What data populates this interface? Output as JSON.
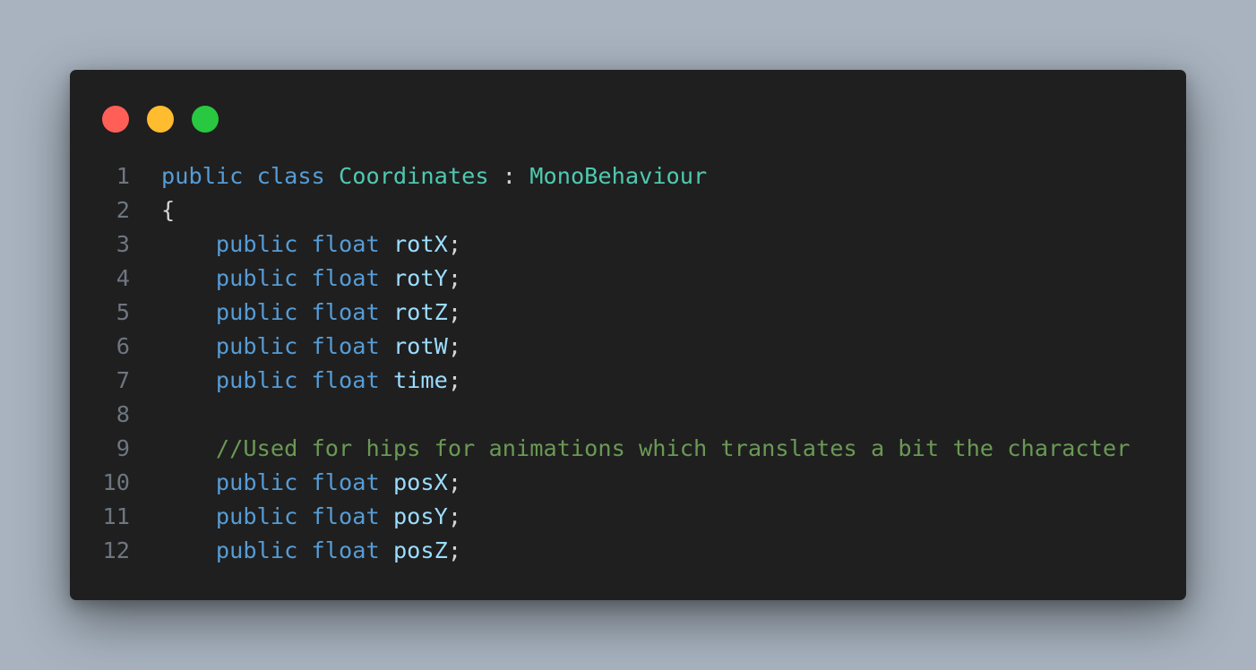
{
  "window": {
    "controls": [
      {
        "name": "close-dot",
        "color": "#ff5f57"
      },
      {
        "name": "minimize-dot",
        "color": "#febc2e"
      },
      {
        "name": "maximize-dot",
        "color": "#28c840"
      }
    ]
  },
  "code": {
    "lines": [
      {
        "number": "1",
        "tokens": [
          {
            "text": "public",
            "kind": "keyword"
          },
          {
            "text": " ",
            "kind": "space"
          },
          {
            "text": "class",
            "kind": "keyword"
          },
          {
            "text": " ",
            "kind": "space"
          },
          {
            "text": "Coordinates",
            "kind": "type"
          },
          {
            "text": " : ",
            "kind": "punct"
          },
          {
            "text": "MonoBehaviour",
            "kind": "type"
          }
        ]
      },
      {
        "number": "2",
        "tokens": [
          {
            "text": "{",
            "kind": "punct"
          }
        ]
      },
      {
        "number": "3",
        "tokens": [
          {
            "text": "    ",
            "kind": "space"
          },
          {
            "text": "public",
            "kind": "keyword"
          },
          {
            "text": " ",
            "kind": "space"
          },
          {
            "text": "float",
            "kind": "keyword"
          },
          {
            "text": " ",
            "kind": "space"
          },
          {
            "text": "rotX",
            "kind": "ident"
          },
          {
            "text": ";",
            "kind": "punct"
          }
        ]
      },
      {
        "number": "4",
        "tokens": [
          {
            "text": "    ",
            "kind": "space"
          },
          {
            "text": "public",
            "kind": "keyword"
          },
          {
            "text": " ",
            "kind": "space"
          },
          {
            "text": "float",
            "kind": "keyword"
          },
          {
            "text": " ",
            "kind": "space"
          },
          {
            "text": "rotY",
            "kind": "ident"
          },
          {
            "text": ";",
            "kind": "punct"
          }
        ]
      },
      {
        "number": "5",
        "tokens": [
          {
            "text": "    ",
            "kind": "space"
          },
          {
            "text": "public",
            "kind": "keyword"
          },
          {
            "text": " ",
            "kind": "space"
          },
          {
            "text": "float",
            "kind": "keyword"
          },
          {
            "text": " ",
            "kind": "space"
          },
          {
            "text": "rotZ",
            "kind": "ident"
          },
          {
            "text": ";",
            "kind": "punct"
          }
        ]
      },
      {
        "number": "6",
        "tokens": [
          {
            "text": "    ",
            "kind": "space"
          },
          {
            "text": "public",
            "kind": "keyword"
          },
          {
            "text": " ",
            "kind": "space"
          },
          {
            "text": "float",
            "kind": "keyword"
          },
          {
            "text": " ",
            "kind": "space"
          },
          {
            "text": "rotW",
            "kind": "ident"
          },
          {
            "text": ";",
            "kind": "punct"
          }
        ]
      },
      {
        "number": "7",
        "tokens": [
          {
            "text": "    ",
            "kind": "space"
          },
          {
            "text": "public",
            "kind": "keyword"
          },
          {
            "text": " ",
            "kind": "space"
          },
          {
            "text": "float",
            "kind": "keyword"
          },
          {
            "text": " ",
            "kind": "space"
          },
          {
            "text": "time",
            "kind": "ident"
          },
          {
            "text": ";",
            "kind": "punct"
          }
        ]
      },
      {
        "number": "8",
        "tokens": []
      },
      {
        "number": "9",
        "tokens": [
          {
            "text": "    ",
            "kind": "space"
          },
          {
            "text": "//Used for hips for animations which translates a bit the character",
            "kind": "comment"
          }
        ]
      },
      {
        "number": "10",
        "tokens": [
          {
            "text": "    ",
            "kind": "space"
          },
          {
            "text": "public",
            "kind": "keyword"
          },
          {
            "text": " ",
            "kind": "space"
          },
          {
            "text": "float",
            "kind": "keyword"
          },
          {
            "text": " ",
            "kind": "space"
          },
          {
            "text": "posX",
            "kind": "ident"
          },
          {
            "text": ";",
            "kind": "punct"
          }
        ]
      },
      {
        "number": "11",
        "tokens": [
          {
            "text": "    ",
            "kind": "space"
          },
          {
            "text": "public",
            "kind": "keyword"
          },
          {
            "text": " ",
            "kind": "space"
          },
          {
            "text": "float",
            "kind": "keyword"
          },
          {
            "text": " ",
            "kind": "space"
          },
          {
            "text": "posY",
            "kind": "ident"
          },
          {
            "text": ";",
            "kind": "punct"
          }
        ]
      },
      {
        "number": "12",
        "tokens": [
          {
            "text": "    ",
            "kind": "space"
          },
          {
            "text": "public",
            "kind": "keyword"
          },
          {
            "text": " ",
            "kind": "space"
          },
          {
            "text": "float",
            "kind": "keyword"
          },
          {
            "text": " ",
            "kind": "space"
          },
          {
            "text": "posZ",
            "kind": "ident"
          },
          {
            "text": ";",
            "kind": "punct"
          }
        ]
      }
    ]
  }
}
